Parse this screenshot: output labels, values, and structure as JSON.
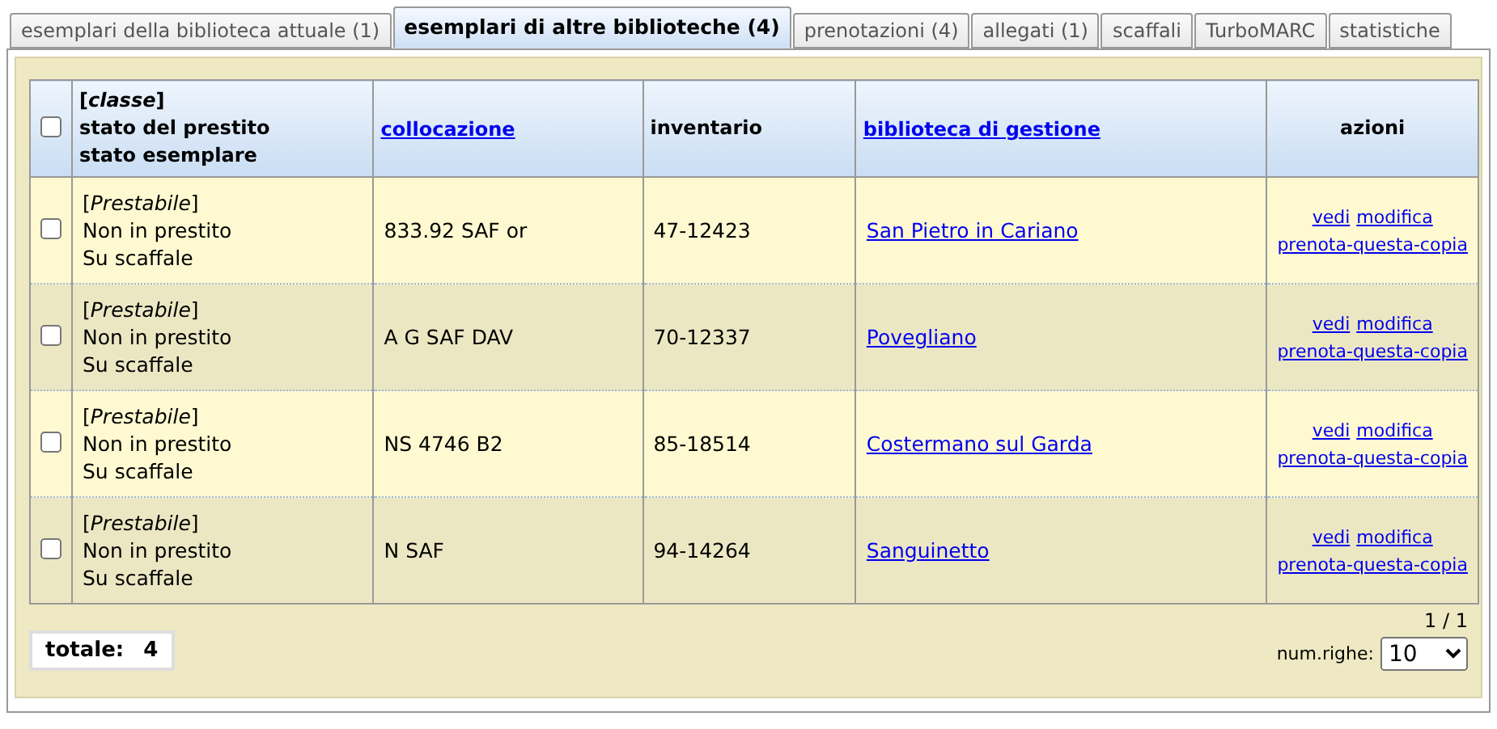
{
  "tabs": [
    {
      "label": "esemplari della biblioteca attuale (1)",
      "selected": false
    },
    {
      "label": "esemplari di altre biblioteche (4)",
      "selected": true
    },
    {
      "label": "prenotazioni (4)",
      "selected": false
    },
    {
      "label": "allegati (1)",
      "selected": false
    },
    {
      "label": "scaffali",
      "selected": false
    },
    {
      "label": "TurboMARC",
      "selected": false
    },
    {
      "label": "statistiche",
      "selected": false
    }
  ],
  "table": {
    "select_all": {
      "checked": false
    },
    "columns": [
      {
        "lines": [
          "[*classe*]",
          "stato del prestito",
          "stato esemplare"
        ],
        "kind": "text"
      },
      {
        "lines": [
          "collocazione"
        ],
        "kind": "link"
      },
      {
        "lines": [
          "inventario"
        ],
        "kind": "text"
      },
      {
        "lines": [
          "biblioteca di gestione"
        ],
        "kind": "link"
      },
      {
        "lines": [
          "azioni"
        ],
        "kind": "actions"
      }
    ],
    "rows": [
      {
        "checked": false,
        "status": [
          "[*Prestabile*]",
          "Non in prestito",
          "Su scaffale"
        ],
        "collocazione": "833.92 SAF or",
        "inventario": "47-12423",
        "biblioteca": "San Pietro in Cariano",
        "actions": [
          "vedi",
          "modifica",
          "prenota-questa-copia"
        ]
      },
      {
        "checked": false,
        "status": [
          "[*Prestabile*]",
          "Non in prestito",
          "Su scaffale"
        ],
        "collocazione": "A G SAF DAV",
        "inventario": "70-12337",
        "biblioteca": "Povegliano",
        "actions": [
          "vedi",
          "modifica",
          "prenota-questa-copia"
        ]
      },
      {
        "checked": false,
        "status": [
          "[*Prestabile*]",
          "Non in prestito",
          "Su scaffale"
        ],
        "collocazione": "NS 4746 B2",
        "inventario": "85-18514",
        "biblioteca": "Costermano sul Garda",
        "actions": [
          "vedi",
          "modifica",
          "prenota-questa-copia"
        ]
      },
      {
        "checked": false,
        "status": [
          "[*Prestabile*]",
          "Non in prestito",
          "Su scaffale"
        ],
        "collocazione": "N SAF",
        "inventario": "94-14264",
        "biblioteca": "Sanguinetto",
        "actions": [
          "vedi",
          "modifica",
          "prenota-questa-copia"
        ]
      }
    ]
  },
  "pager": {
    "page": "1 / 1",
    "rows_label": "num.righe:",
    "rows_value": "10"
  },
  "total": {
    "label": "totale:",
    "value": "4"
  }
}
